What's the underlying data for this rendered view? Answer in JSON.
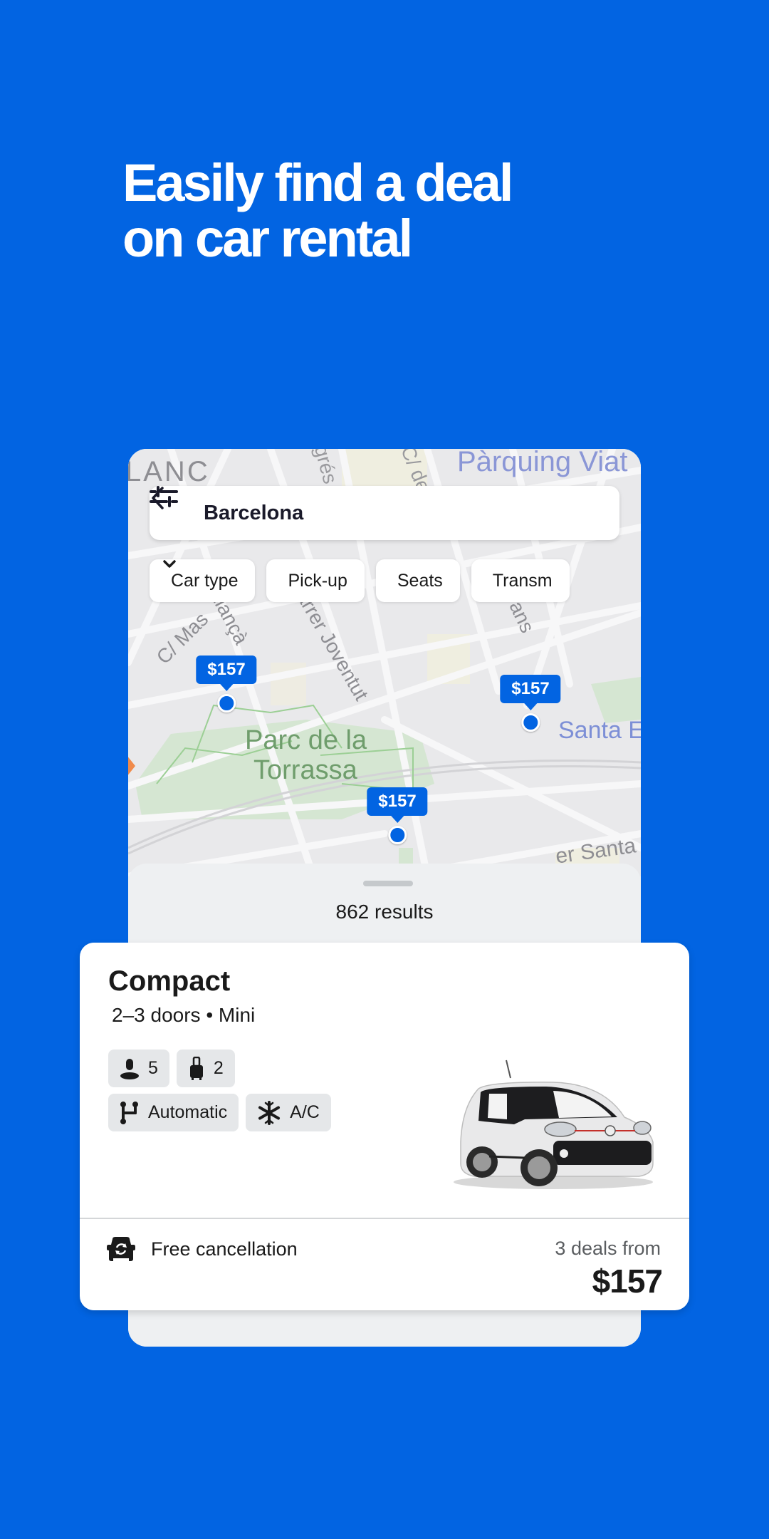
{
  "headline": {
    "line1": "Easily find a deal",
    "line2": "on car rental"
  },
  "colors": {
    "brand": "#0264e2",
    "background": "#0264e2",
    "sheet": "#eef0f2"
  },
  "search": {
    "location": "Barcelona",
    "back_icon": "chevron-left-icon",
    "filter_icon": "sliders-icon"
  },
  "filters": [
    {
      "label": "Car type"
    },
    {
      "label": "Pick-up"
    },
    {
      "label": "Seats"
    },
    {
      "label": "Transm"
    }
  ],
  "map": {
    "labels": {
      "area_top_left": "LANC",
      "parking": "Pàrquing Viat",
      "street_gres": "grés",
      "street_cd": "C/ de",
      "street_mas": "C/ Mas",
      "street_llanca": "Llançà",
      "street_joventut": "arrer Joventut",
      "street_ans": "ans",
      "park_line1": "Parc de la",
      "park_line2": "Torrassa",
      "santa": "Santa E",
      "santa_bottom": "er Santa"
    },
    "pins": [
      {
        "price": "$157"
      },
      {
        "price": "$157"
      },
      {
        "price": "$157"
      }
    ]
  },
  "results": {
    "count_text": "862 results"
  },
  "listing": {
    "category": "Compact",
    "subtitle": "2–3 doors • Mini",
    "seats": "5",
    "bags": "2",
    "transmission": "Automatic",
    "ac": "A/C",
    "cancellation": "Free cancellation",
    "deals_text": "3 deals from",
    "price": "$157"
  }
}
